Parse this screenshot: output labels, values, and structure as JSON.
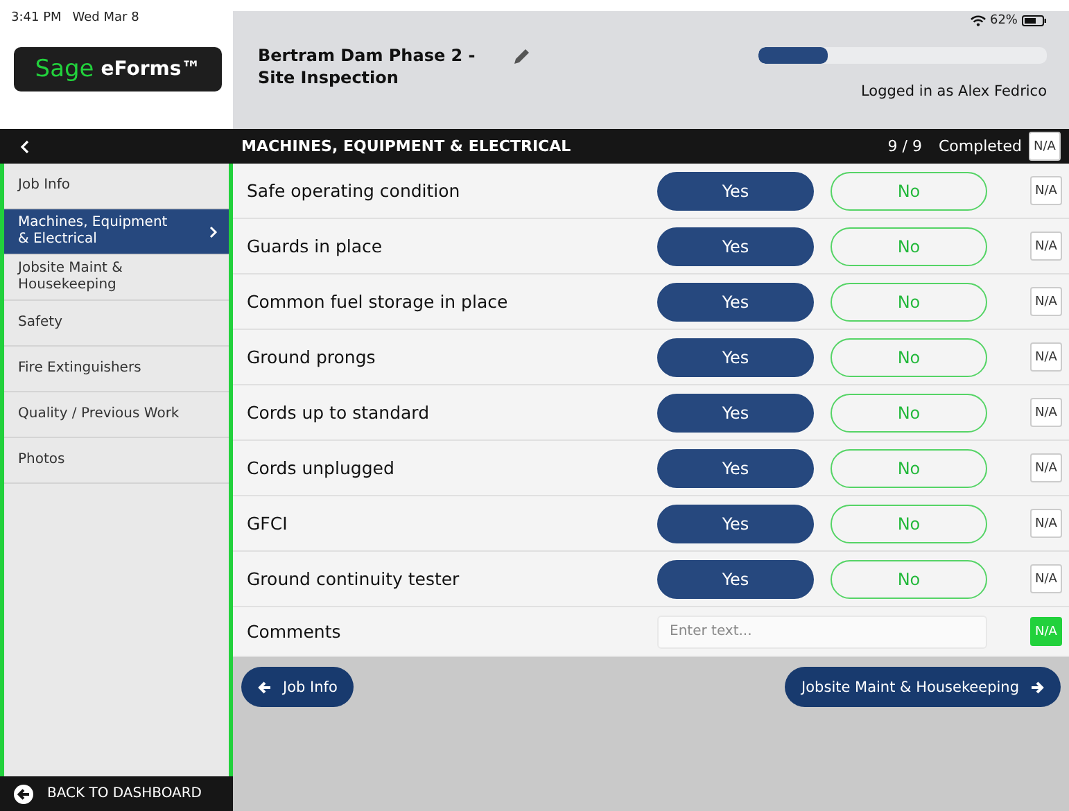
{
  "status_bar": {
    "time": "3:41 PM",
    "date": "Wed Mar 8",
    "battery": "62%"
  },
  "logo": {
    "brand": "Sage",
    "product": "eForms™"
  },
  "form": {
    "title": "Bertram Dam Phase 2 - Site Inspection",
    "progress": {
      "level": 0.24
    },
    "user": "Logged in as Alex Fedrico"
  },
  "section_bar": {
    "title": "MACHINES, EQUIPMENT & ELECTRICAL",
    "count": "9 / 9",
    "status": "Completed",
    "na": {
      "label": "N/A",
      "selected": false
    }
  },
  "sidebar": {
    "items": [
      {
        "label": "Job Info",
        "selected": false
      },
      {
        "label": "Machines, Equipment & Electrical",
        "selected": true
      },
      {
        "label": "Jobsite Maint & Housekeeping",
        "selected": false
      },
      {
        "label": "Safety",
        "selected": false
      },
      {
        "label": "Fire Extinguishers",
        "selected": false
      },
      {
        "label": "Quality / Previous Work",
        "selected": false
      },
      {
        "label": "Photos",
        "selected": false
      }
    ],
    "back": "BACK TO DASHBOARD"
  },
  "questions": [
    {
      "kind": "choice",
      "label": "Safe operating condition",
      "options": [
        {
          "label": "Yes",
          "selected": true
        },
        {
          "label": "No",
          "selected": false
        }
      ],
      "na": {
        "label": "N/A",
        "selected": false
      }
    },
    {
      "kind": "choice",
      "label": "Guards in place",
      "options": [
        {
          "label": "Yes",
          "selected": true
        },
        {
          "label": "No",
          "selected": false
        }
      ],
      "na": {
        "label": "N/A",
        "selected": false
      }
    },
    {
      "kind": "choice",
      "label": "Common fuel storage in place",
      "options": [
        {
          "label": "Yes",
          "selected": true
        },
        {
          "label": "No",
          "selected": false
        }
      ],
      "na": {
        "label": "N/A",
        "selected": false
      }
    },
    {
      "kind": "choice",
      "label": "Ground prongs",
      "options": [
        {
          "label": "Yes",
          "selected": true
        },
        {
          "label": "No",
          "selected": false
        }
      ],
      "na": {
        "label": "N/A",
        "selected": false
      }
    },
    {
      "kind": "choice",
      "label": "Cords up to standard",
      "options": [
        {
          "label": "Yes",
          "selected": true
        },
        {
          "label": "No",
          "selected": false
        }
      ],
      "na": {
        "label": "N/A",
        "selected": false
      }
    },
    {
      "kind": "choice",
      "label": "Cords unplugged",
      "options": [
        {
          "label": "Yes",
          "selected": true
        },
        {
          "label": "No",
          "selected": false
        }
      ],
      "na": {
        "label": "N/A",
        "selected": false
      }
    },
    {
      "kind": "choice",
      "label": "GFCI",
      "options": [
        {
          "label": "Yes",
          "selected": true
        },
        {
          "label": "No",
          "selected": false
        }
      ],
      "na": {
        "label": "N/A",
        "selected": false
      }
    },
    {
      "kind": "choice",
      "label": "Ground continuity tester",
      "options": [
        {
          "label": "Yes",
          "selected": true
        },
        {
          "label": "No",
          "selected": false
        }
      ],
      "na": {
        "label": "N/A",
        "selected": false
      }
    },
    {
      "kind": "text",
      "label": "Comments",
      "placeholder": "Enter text...",
      "na": {
        "label": "N/A",
        "selected": true
      }
    }
  ],
  "nav": {
    "previous": "Job Info",
    "next": "Jobsite Maint & Housekeeping"
  }
}
